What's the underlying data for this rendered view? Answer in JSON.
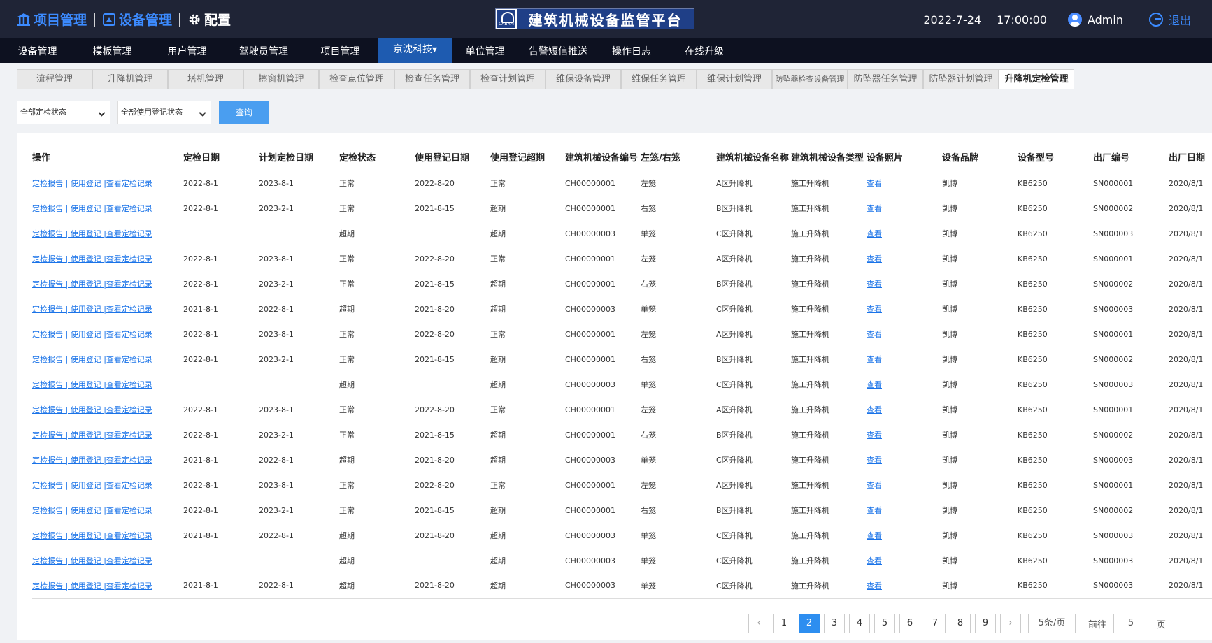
{
  "header": {
    "nav": [
      "项目管理",
      "设备管理",
      "配置"
    ],
    "logo_badge": "CABRM",
    "logo_title": "建筑机械设备监管平台",
    "date": "2022-7-24",
    "time": "17:00:00",
    "user": "Admin",
    "logout": "退出"
  },
  "menu": [
    {
      "label": "设备管理"
    },
    {
      "label": "模板管理"
    },
    {
      "label": "用户管理"
    },
    {
      "label": "驾驶员管理"
    },
    {
      "label": "项目管理"
    },
    {
      "label": "京沈科技▾"
    },
    {
      "label": "单位管理"
    },
    {
      "label": "告警短信推送"
    },
    {
      "label": "操作日志"
    },
    {
      "label": "在线升级"
    }
  ],
  "tabs": [
    "流程管理",
    "升降机管理",
    "塔机管理",
    "擦窗机管理",
    "检查点位管理",
    "检查任务管理",
    "检查计划管理",
    "维保设备管理",
    "维保任务管理",
    "维保计划管理",
    "防坠器检查设备管理",
    "防坠器任务管理",
    "防坠器计划管理",
    "升降机定检管理"
  ],
  "filters": {
    "status": "全部定检状态",
    "registration": "全部使用登记状态",
    "query": "查询"
  },
  "table": {
    "columns": [
      "操作",
      "定检日期",
      "计划定检日期",
      "定检状态",
      "使用登记日期",
      "使用登记超期",
      "建筑机械设备编号",
      "左笼/右笼",
      "建筑机械设备名称",
      "建筑机械设备类型",
      "设备照片",
      "设备品牌",
      "设备型号",
      "出厂编号",
      "出厂日期"
    ],
    "action_text": "定检报告 | 使用登记 |查看定检记录",
    "photo_text": "查看",
    "rows": [
      [
        "2022-8-1",
        "2023-8-1",
        "正常",
        "2022-8-20",
        "正常",
        "CH00000001",
        "左笼",
        "A区升降机",
        "施工升降机",
        "凯博",
        "KB6250",
        "SN000001",
        "2020/8/1"
      ],
      [
        "2022-8-1",
        "2023-2-1",
        "正常",
        "2021-8-15",
        "超期",
        "CH00000001",
        "右笼",
        "B区升降机",
        "施工升降机",
        "凯博",
        "KB6250",
        "SN000002",
        "2020/8/1"
      ],
      [
        "",
        "",
        "超期",
        "",
        "超期",
        "CH00000003",
        "单笼",
        "C区升降机",
        "施工升降机",
        "凯博",
        "KB6250",
        "SN000003",
        "2020/8/1"
      ],
      [
        "2022-8-1",
        "2023-8-1",
        "正常",
        "2022-8-20",
        "正常",
        "CH00000001",
        "左笼",
        "A区升降机",
        "施工升降机",
        "凯博",
        "KB6250",
        "SN000001",
        "2020/8/1"
      ],
      [
        "2022-8-1",
        "2023-2-1",
        "正常",
        "2021-8-15",
        "超期",
        "CH00000001",
        "右笼",
        "B区升降机",
        "施工升降机",
        "凯博",
        "KB6250",
        "SN000002",
        "2020/8/1"
      ],
      [
        "2021-8-1",
        "2022-8-1",
        "超期",
        "2021-8-20",
        "超期",
        "CH00000003",
        "单笼",
        "C区升降机",
        "施工升降机",
        "凯博",
        "KB6250",
        "SN000003",
        "2020/8/1"
      ],
      [
        "2022-8-1",
        "2023-8-1",
        "正常",
        "2022-8-20",
        "正常",
        "CH00000001",
        "左笼",
        "A区升降机",
        "施工升降机",
        "凯博",
        "KB6250",
        "SN000001",
        "2020/8/1"
      ],
      [
        "2022-8-1",
        "2023-2-1",
        "正常",
        "2021-8-15",
        "超期",
        "CH00000001",
        "右笼",
        "B区升降机",
        "施工升降机",
        "凯博",
        "KB6250",
        "SN000002",
        "2020/8/1"
      ],
      [
        "",
        "",
        "超期",
        "",
        "超期",
        "CH00000003",
        "单笼",
        "C区升降机",
        "施工升降机",
        "凯博",
        "KB6250",
        "SN000003",
        "2020/8/1"
      ],
      [
        "2022-8-1",
        "2023-8-1",
        "正常",
        "2022-8-20",
        "正常",
        "CH00000001",
        "左笼",
        "A区升降机",
        "施工升降机",
        "凯博",
        "KB6250",
        "SN000001",
        "2020/8/1"
      ],
      [
        "2022-8-1",
        "2023-2-1",
        "正常",
        "2021-8-15",
        "超期",
        "CH00000001",
        "右笼",
        "B区升降机",
        "施工升降机",
        "凯博",
        "KB6250",
        "SN000002",
        "2020/8/1"
      ],
      [
        "2021-8-1",
        "2022-8-1",
        "超期",
        "2021-8-20",
        "超期",
        "CH00000003",
        "单笼",
        "C区升降机",
        "施工升降机",
        "凯博",
        "KB6250",
        "SN000003",
        "2020/8/1"
      ],
      [
        "2022-8-1",
        "2023-8-1",
        "正常",
        "2022-8-20",
        "正常",
        "CH00000001",
        "左笼",
        "A区升降机",
        "施工升降机",
        "凯博",
        "KB6250",
        "SN000001",
        "2020/8/1"
      ],
      [
        "2022-8-1",
        "2023-2-1",
        "正常",
        "2021-8-15",
        "超期",
        "CH00000001",
        "右笼",
        "B区升降机",
        "施工升降机",
        "凯博",
        "KB6250",
        "SN000002",
        "2020/8/1"
      ],
      [
        "2021-8-1",
        "2022-8-1",
        "超期",
        "2021-8-20",
        "超期",
        "CH00000003",
        "单笼",
        "C区升降机",
        "施工升降机",
        "凯博",
        "KB6250",
        "SN000003",
        "2020/8/1"
      ],
      [
        "",
        "",
        "超期",
        "",
        "超期",
        "CH00000003",
        "单笼",
        "C区升降机",
        "施工升降机",
        "凯博",
        "KB6250",
        "SN000003",
        "2020/8/1"
      ],
      [
        "2021-8-1",
        "2022-8-1",
        "超期",
        "2021-8-20",
        "超期",
        "CH00000003",
        "单笼",
        "C区升降机",
        "施工升降机",
        "凯博",
        "KB6250",
        "SN000003",
        "2020/8/1"
      ]
    ]
  },
  "pager": {
    "prev": "‹",
    "next": "›",
    "pages": [
      "1",
      "2",
      "3",
      "4",
      "5",
      "6",
      "7",
      "8",
      "9"
    ],
    "current": "2",
    "page_size": "5条/页",
    "goto_label": "前往",
    "goto_value": "5",
    "page_unit": "页"
  }
}
